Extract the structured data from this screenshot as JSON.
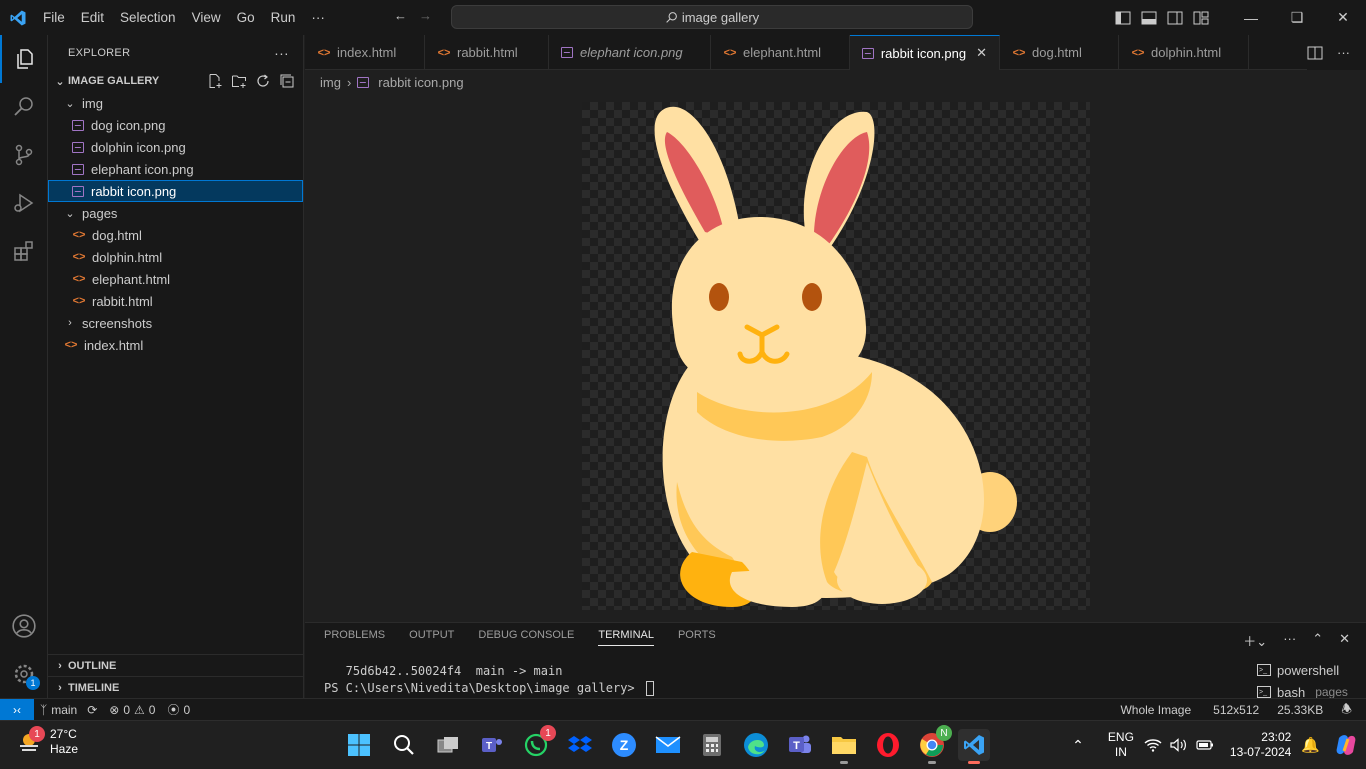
{
  "titlebar": {
    "menu": [
      "File",
      "Edit",
      "Selection",
      "View",
      "Go",
      "Run",
      "···"
    ],
    "search_text": "image gallery",
    "window_controls": [
      "minimize",
      "restore",
      "close"
    ]
  },
  "activity_bar": {
    "items": [
      "explorer-icon",
      "search-icon",
      "source-control-icon",
      "run-debug-icon",
      "extensions-icon"
    ],
    "bottom": [
      "account-icon",
      "settings-icon"
    ],
    "settings_badge": "1"
  },
  "sidebar": {
    "title": "EXPLORER",
    "more": "···",
    "folder": "IMAGE GALLERY",
    "tree": {
      "img_folder": "img",
      "img_files": [
        "dog icon.png",
        "dolphin icon.png",
        "elephant icon.png",
        "rabbit icon.png"
      ],
      "pages_folder": "pages",
      "page_files": [
        "dog.html",
        "dolphin.html",
        "elephant.html",
        "rabbit.html"
      ],
      "screenshots_folder": "screenshots",
      "root_file": "index.html"
    },
    "outline": "OUTLINE",
    "timeline": "TIMELINE"
  },
  "tabs": [
    {
      "label": "index.html",
      "type": "html"
    },
    {
      "label": "rabbit.html",
      "type": "html"
    },
    {
      "label": "elephant icon.png",
      "type": "img"
    },
    {
      "label": "elephant.html",
      "type": "html"
    },
    {
      "label": "rabbit icon.png",
      "type": "img"
    },
    {
      "label": "dog.html",
      "type": "html"
    },
    {
      "label": "dolphin.html",
      "type": "html"
    }
  ],
  "breadcrumb": {
    "folder": "img",
    "file": "rabbit icon.png"
  },
  "panel": {
    "tabs": [
      "PROBLEMS",
      "OUTPUT",
      "DEBUG CONSOLE",
      "TERMINAL",
      "PORTS"
    ],
    "active_tab": "TERMINAL",
    "terminal_lines": [
      "   75d6b42..50024f4  main -> main",
      "PS C:\\Users\\Nivedita\\Desktop\\image gallery> "
    ],
    "terminals": [
      {
        "name": "powershell",
        "sub": ""
      },
      {
        "name": "bash",
        "sub": "pages"
      }
    ]
  },
  "statusbar": {
    "branch": "main",
    "errors": "0",
    "warnings": "0",
    "ports": "0",
    "view": "Whole Image",
    "dimensions": "512x512",
    "size": "25.33KB"
  },
  "taskbar": {
    "temperature": "27°C",
    "weather": "Haze",
    "weather_badge": "1",
    "whatsapp_badge": "1",
    "chrome_badge": "N",
    "lang_top": "ENG",
    "lang_bottom": "IN",
    "time": "23:02",
    "date": "13-07-2024"
  },
  "colors": {
    "accent": "#0078d4",
    "rabbit_body": "#ffe0a3",
    "rabbit_ear": "#e05c5c",
    "rabbit_shade": "#ffc857",
    "rabbit_eye": "#b3530e"
  }
}
